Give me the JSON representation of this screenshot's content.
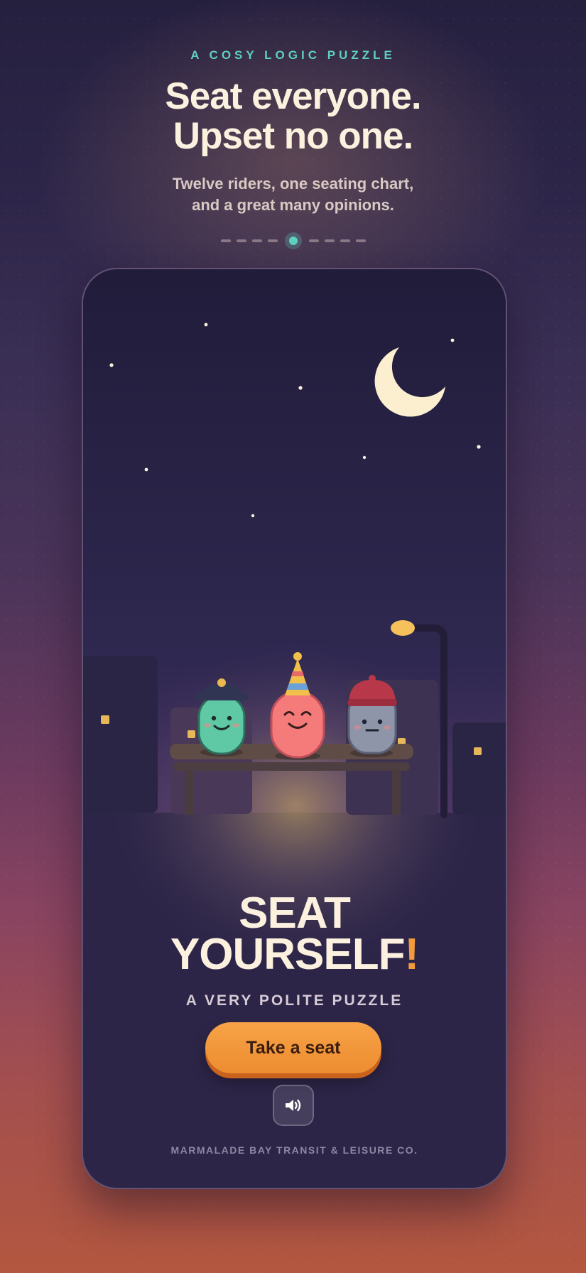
{
  "header": {
    "eyebrow": "A COSY LOGIC PUZZLE",
    "headline_line1": "Seat everyone.",
    "headline_line2": "Upset no one.",
    "subtitle_line1": "Twelve riders, one seating chart,",
    "subtitle_line2": "and a great many opinions."
  },
  "pager": {
    "total": 9,
    "active_index": 4
  },
  "game": {
    "title_line1": "SEAT",
    "title_line2": "YOURSELF",
    "title_bang": "!",
    "tagline": "A VERY POLITE PUZZLE",
    "cta_label": "Take a seat",
    "sound_icon": "speaker-icon",
    "footer": "MARMALADE BAY TRANSIT & LEISURE CO."
  },
  "colors": {
    "accent_teal": "#5fd0c0",
    "accent_orange": "#f29a3c",
    "headline": "#fbf1de",
    "card_bg": "#2c2547"
  }
}
